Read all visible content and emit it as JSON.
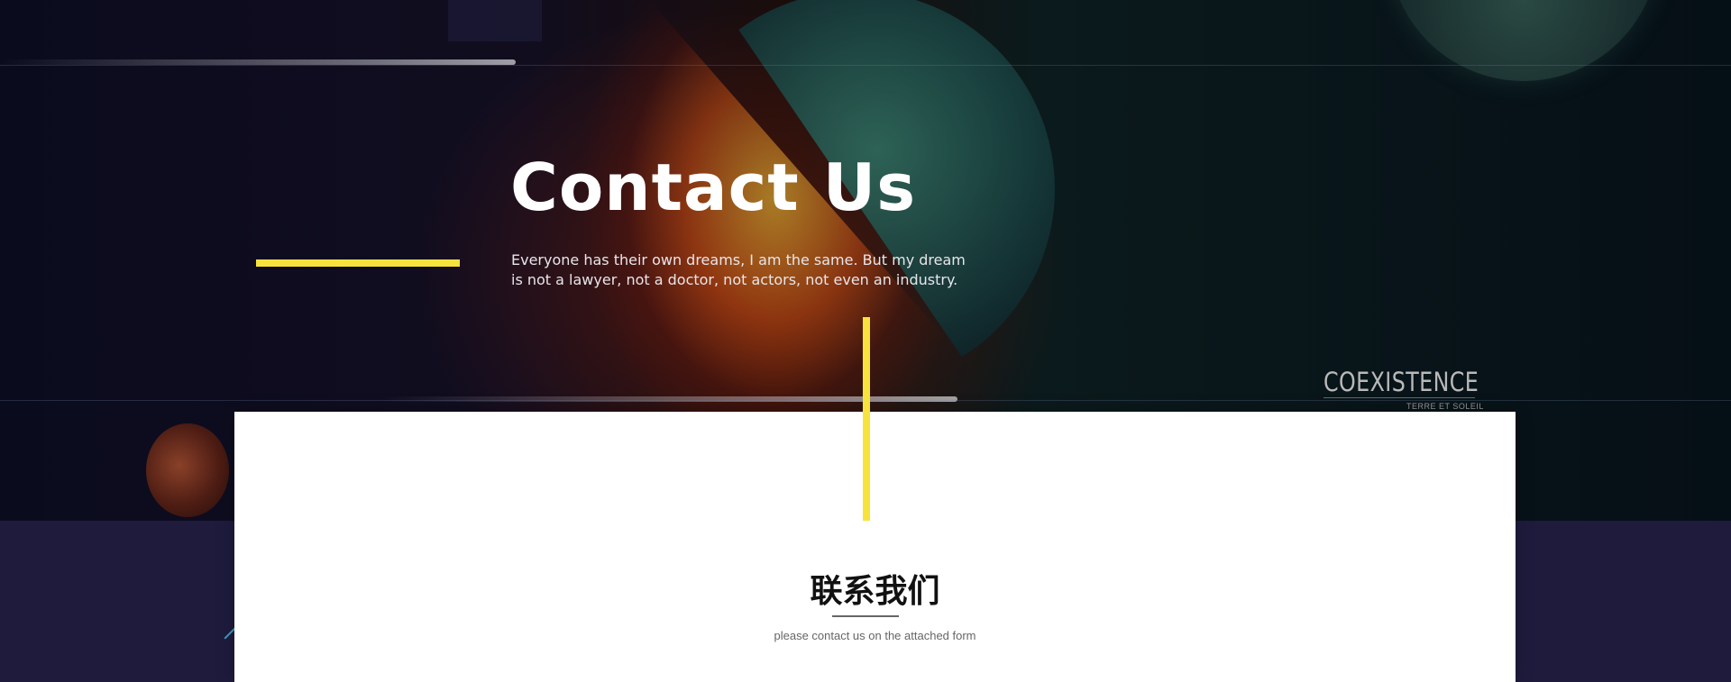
{
  "hero": {
    "title": "Contact Us",
    "description": "Everyone has their own dreams, I am the same. But my dream is not a lawyer, not a doctor, not actors, not even an industry.",
    "brand": {
      "name": "COEXISTENCE",
      "tagline": "TERRE ET SOLEIL"
    },
    "accent_color": "#f7e33c"
  },
  "contact_section": {
    "title": "联系我们",
    "subtitle": "please contact us on the attached form"
  },
  "colors": {
    "page_background": "#1e1b3d",
    "card_background": "#ffffff",
    "accent": "#f7e33c"
  }
}
